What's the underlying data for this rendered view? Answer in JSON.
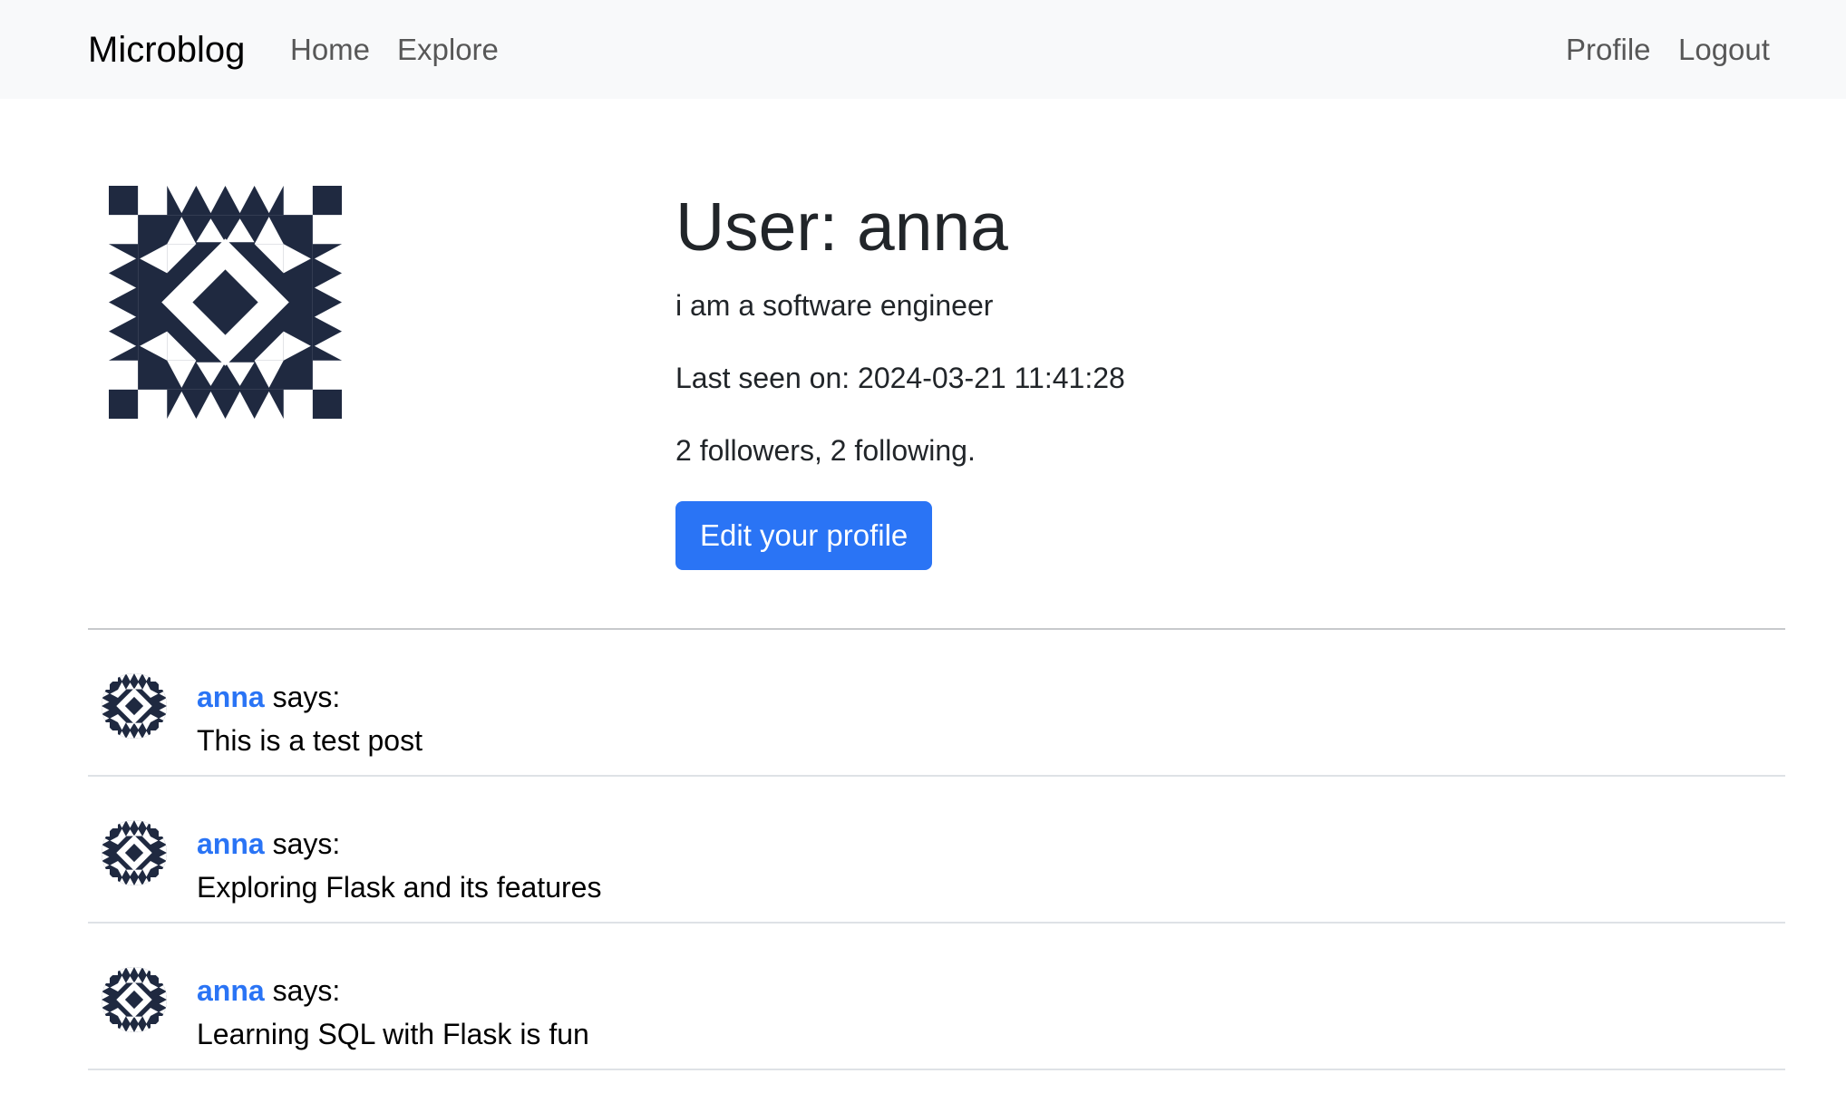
{
  "navbar": {
    "brand": "Microblog",
    "links": [
      {
        "label": "Home"
      },
      {
        "label": "Explore"
      }
    ],
    "right_links": [
      {
        "label": "Profile"
      },
      {
        "label": "Logout"
      }
    ]
  },
  "profile": {
    "title": "User: anna",
    "about": "i am a software engineer",
    "last_seen": "Last seen on: 2024-03-21 11:41:28",
    "follow_counts": "2 followers, 2 following.",
    "edit_button": "Edit your profile",
    "avatar_icon": "identicon-avatar"
  },
  "posts": [
    {
      "author": "anna",
      "says": " says:",
      "body": "This is a test post"
    },
    {
      "author": "anna",
      "says": " says:",
      "body": "Exploring Flask and its features"
    },
    {
      "author": "anna",
      "says": " says:",
      "body": "Learning SQL with Flask is fun"
    }
  ],
  "colors": {
    "navbar_bg": "#f8f9fa",
    "accent": "#2a74f5",
    "avatar_fill": "#1f2940"
  }
}
